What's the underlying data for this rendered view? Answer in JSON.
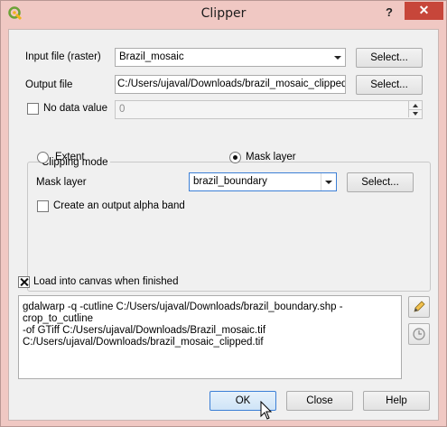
{
  "window": {
    "title": "Clipper",
    "help_button": "?",
    "close_button": "✕"
  },
  "colors": {
    "titlebar": "#f0c8c3",
    "close": "#c7463a",
    "client": "#f0f0f0"
  },
  "input_file": {
    "label": "Input file (raster)",
    "value": "Brazil_mosaic",
    "select_label": "Select..."
  },
  "output_file": {
    "label": "Output file",
    "value": "C:/Users/ujaval/Downloads/brazil_mosaic_clipped.tif",
    "select_label": "Select..."
  },
  "no_data": {
    "label": "No data value",
    "checked": false,
    "value": "0"
  },
  "clipping_mode": {
    "title": "Clipping mode",
    "extent_label": "Extent",
    "mask_layer_radio_label": "Mask layer",
    "selected": "Mask layer",
    "mask_layer": {
      "label": "Mask layer",
      "value": "brazil_boundary",
      "select_label": "Select..."
    },
    "alpha_band": {
      "label": "Create an output alpha band",
      "checked": false
    }
  },
  "load_canvas": {
    "label": "Load into canvas when finished",
    "checked": true
  },
  "command": "gdalwarp -q -cutline C:/Users/ujaval/Downloads/brazil_boundary.shp -crop_to_cutline\n-of GTiff C:/Users/ujaval/Downloads/Brazil_mosaic.tif\nC:/Users/ujaval/Downloads/brazil_mosaic_clipped.tif",
  "tools": {
    "edit_icon": "pencil-icon",
    "reset_icon": "reset-icon"
  },
  "buttons": {
    "ok": "OK",
    "close": "Close",
    "help": "Help"
  }
}
